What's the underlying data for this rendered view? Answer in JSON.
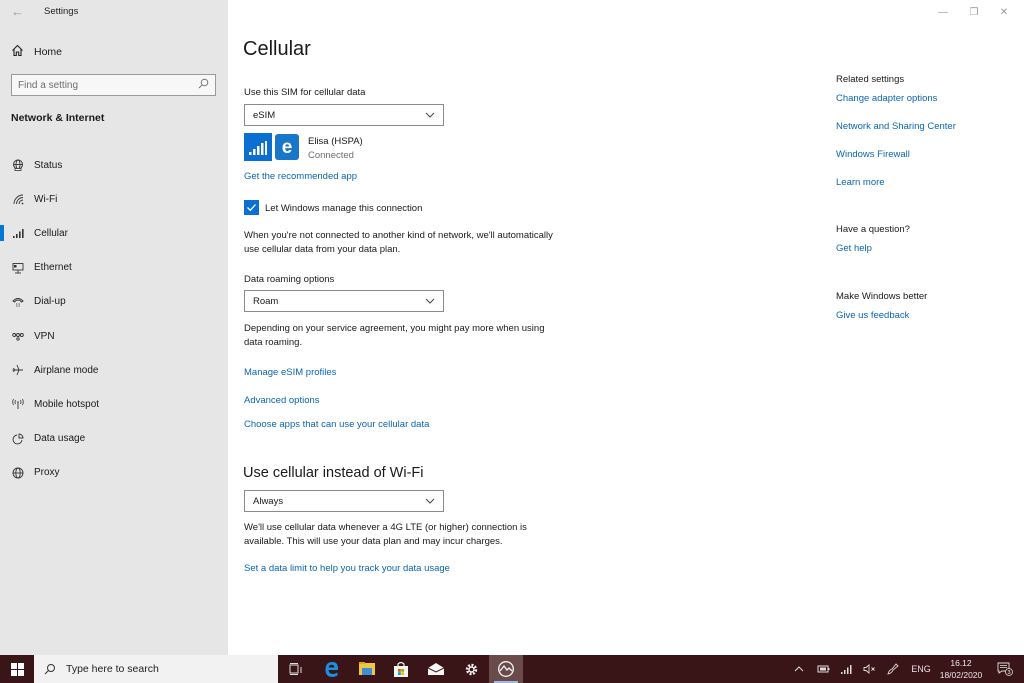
{
  "window": {
    "title": "Settings",
    "controls": {
      "minimize": "—",
      "maximize": "❐",
      "close": "✕"
    }
  },
  "sidebar": {
    "home_label": "Home",
    "search_placeholder": "Find a setting",
    "section_title": "Network & Internet",
    "items": [
      {
        "label": "Status",
        "icon": "status-globe-icon"
      },
      {
        "label": "Wi-Fi",
        "icon": "wifi-icon"
      },
      {
        "label": "Cellular",
        "icon": "cellular-icon",
        "active": true
      },
      {
        "label": "Ethernet",
        "icon": "ethernet-icon"
      },
      {
        "label": "Dial-up",
        "icon": "dialup-icon"
      },
      {
        "label": "VPN",
        "icon": "vpn-icon"
      },
      {
        "label": "Airplane mode",
        "icon": "airplane-icon"
      },
      {
        "label": "Mobile hotspot",
        "icon": "hotspot-icon"
      },
      {
        "label": "Data usage",
        "icon": "data-usage-icon"
      },
      {
        "label": "Proxy",
        "icon": "proxy-globe-icon"
      }
    ]
  },
  "main": {
    "title": "Cellular",
    "sim": {
      "label": "Use this SIM for cellular data",
      "selected": "eSIM",
      "carrier_name": "Elisa (HSPA)",
      "carrier_status": "Connected",
      "carrier_logo_letter": "e",
      "recommended_app_link": "Get the recommended app"
    },
    "manage_connection": {
      "checked": true,
      "label": "Let Windows manage this connection",
      "description": "When you're not connected to another kind of network, we'll automatically use cellular data from your data plan."
    },
    "roaming": {
      "label": "Data roaming options",
      "selected": "Roam",
      "description": "Depending on your service agreement, you might pay more when using data roaming."
    },
    "links": {
      "manage_esim": "Manage eSIM profiles",
      "advanced": "Advanced options",
      "choose_apps": "Choose apps that can use your cellular data"
    },
    "cellular_vs_wifi": {
      "heading": "Use cellular instead of Wi-Fi",
      "selected": "Always",
      "description": "We'll use cellular data whenever a 4G LTE (or higher) connection is available. This will use your data plan and may incur charges.",
      "data_limit_link": "Set a data limit to help you track your data usage"
    }
  },
  "related": {
    "heading": "Related settings",
    "links": [
      "Change adapter options",
      "Network and Sharing Center",
      "Windows Firewall",
      "Learn more"
    ],
    "question_heading": "Have a question?",
    "help_link": "Get help",
    "better_heading": "Make Windows better",
    "feedback_link": "Give us feedback"
  },
  "taskbar": {
    "search_placeholder": "Type here to search",
    "language": "ENG",
    "time": "16.12",
    "date": "18/02/2020",
    "notification_count": "3"
  },
  "colors": {
    "accent": "#0078d7",
    "link": "#0a66b3",
    "taskbar": "#3a1517",
    "sidebar": "#e6e6e6"
  }
}
